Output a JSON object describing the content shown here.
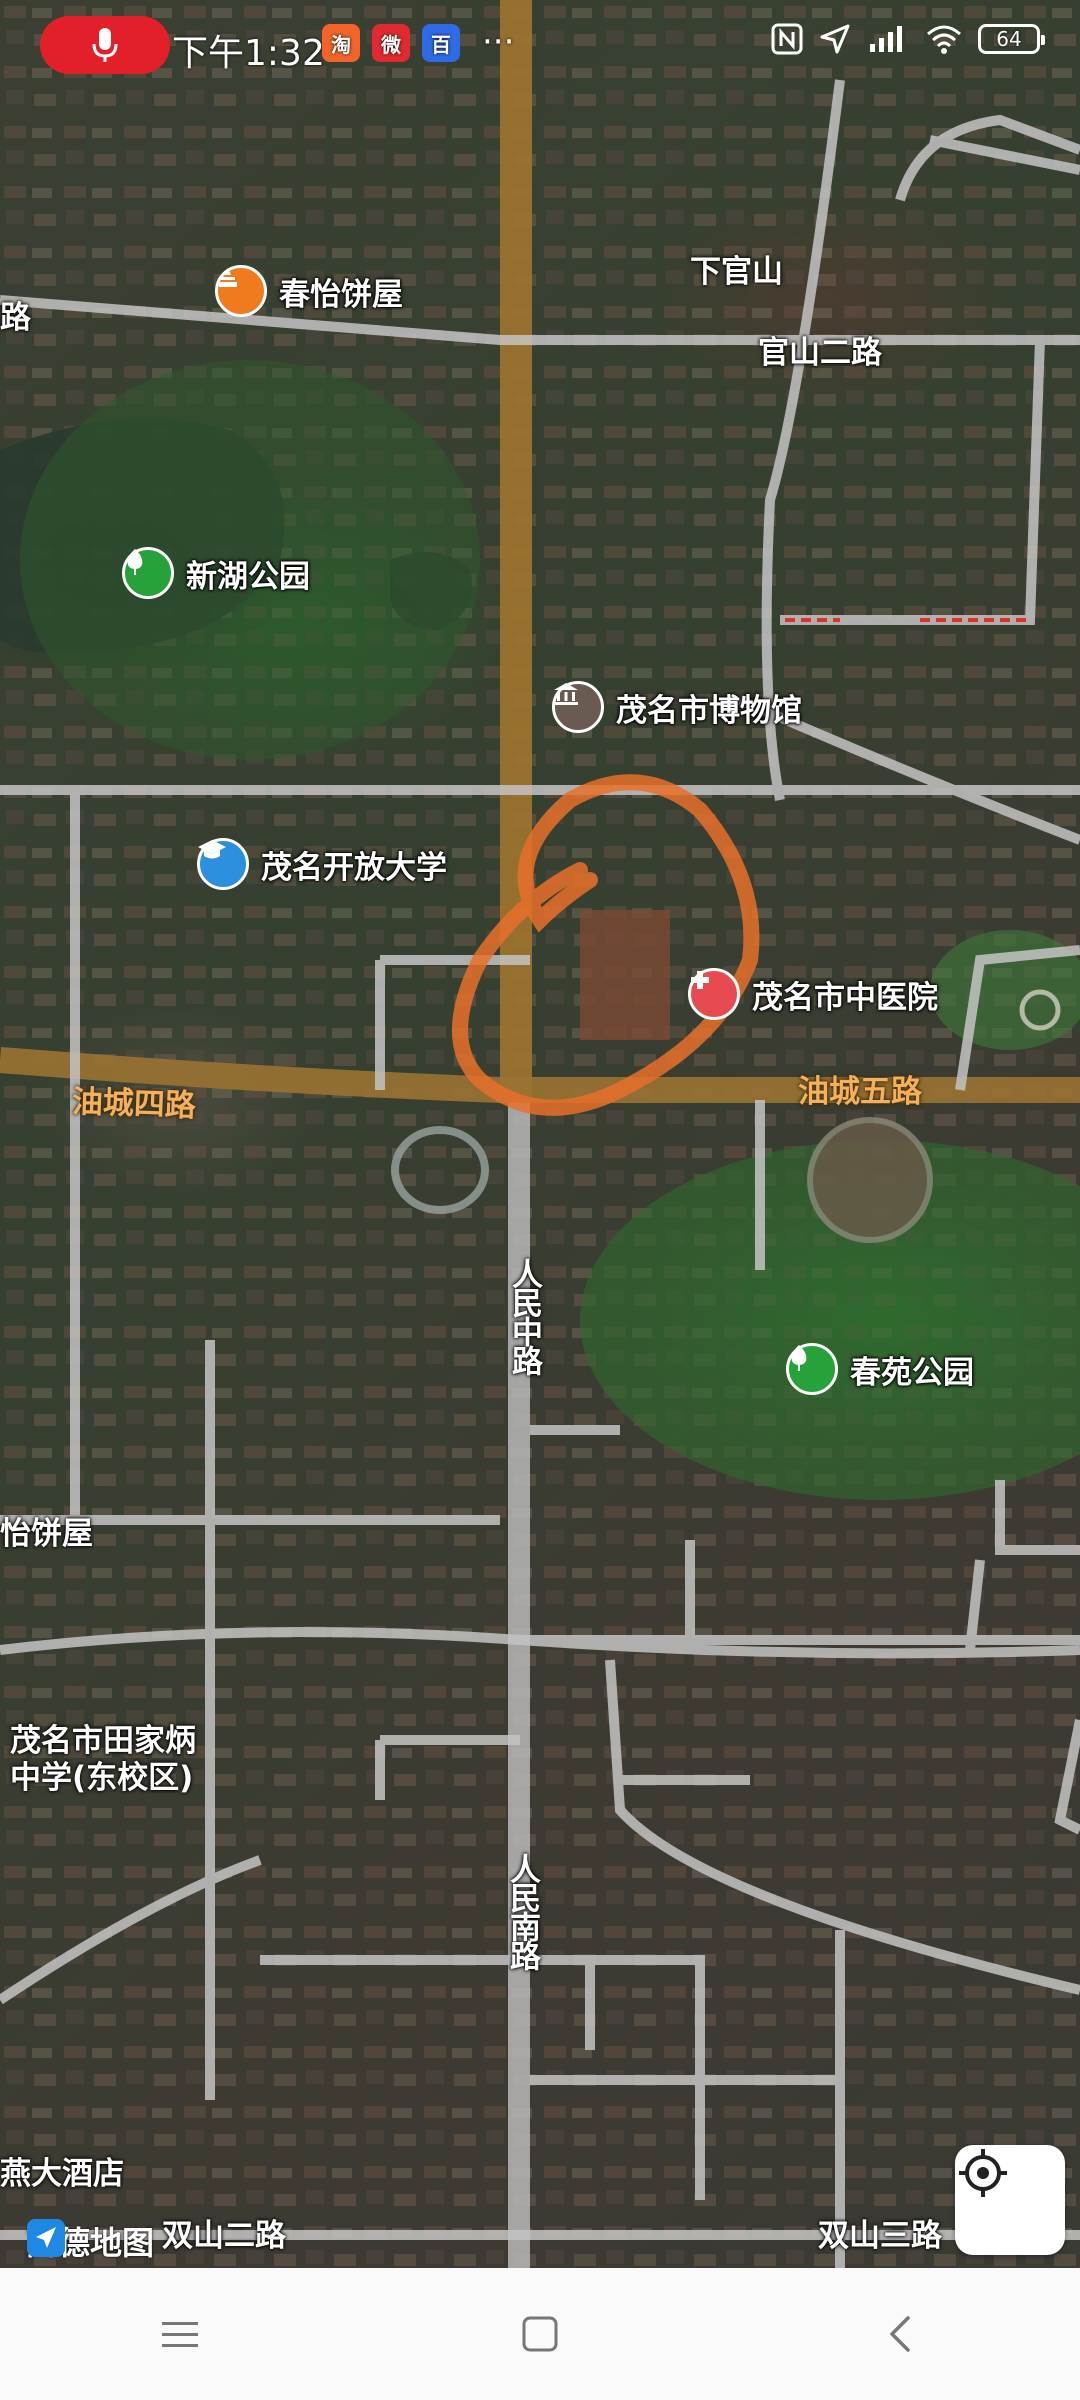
{
  "status_bar": {
    "time": "下午1:32",
    "more_glyph": "···",
    "battery": "64",
    "icons": [
      "microphone-icon",
      "taobao-icon",
      "weibo-icon",
      "baidu-icon",
      "nfc-icon",
      "location-arrow-icon",
      "signal-icon",
      "wifi-icon",
      "battery-icon"
    ],
    "app_badges": [
      "淘",
      "微",
      "百"
    ],
    "mic_color": "#e3202a"
  },
  "map": {
    "pois": [
      {
        "name": "春怡饼屋",
        "icon": "bakery-icon",
        "color": "#f07a1e"
      },
      {
        "name": "新湖公园",
        "icon": "park-icon",
        "color": "#27a23a"
      },
      {
        "name": "茂名市博物馆",
        "icon": "museum-icon",
        "color": "#6b5a52"
      },
      {
        "name": "茂名开放大学",
        "icon": "university-icon",
        "color": "#2d8fe0"
      },
      {
        "name": "茂名市中医院",
        "icon": "hospital-icon",
        "color": "#e84a52"
      },
      {
        "name": "春苑公园",
        "icon": "park-icon",
        "color": "#27a23a"
      }
    ],
    "places": {
      "xia_guan_shan": "下官山",
      "tianjiabing_school_line1": "茂名市田家炳",
      "tianjiabing_school_line2": "中学(东校区)",
      "edge_bakery": "怡饼屋",
      "edge_hotel": "燕大酒店",
      "edge_road": "路"
    },
    "roads": {
      "guanshan_er": "官山二路",
      "youcheng_si": "油城四路",
      "youcheng_wu": "油城五路",
      "renmin_zhong": "人民中路",
      "renmin_nan": "人民南路",
      "shuangshan_er": "双山二路",
      "shuangshan_san": "双山三路"
    },
    "annotation_color": "#e8702a",
    "provider": "高德地图"
  },
  "controls": {
    "locate_icon": "locate-crosshair-icon"
  },
  "nav_bar": {
    "icons": [
      "menu-icon",
      "home-icon",
      "back-icon"
    ]
  }
}
